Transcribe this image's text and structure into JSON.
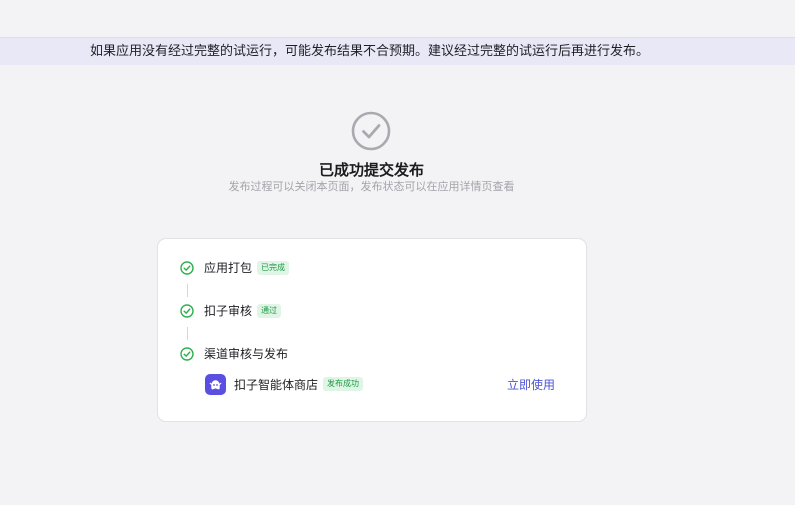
{
  "banner": {
    "text": "如果应用没有经过完整的试运行，可能发布结果不合预期。建议经过完整的试运行后再进行发布。"
  },
  "result": {
    "title": "已成功提交发布",
    "subtitle": "发布过程可以关闭本页面，发布状态可以在应用详情页查看"
  },
  "steps": [
    {
      "label": "应用打包",
      "tag": "已完成",
      "icon": "check-circle-icon"
    },
    {
      "label": "扣子审核",
      "tag": "通过",
      "icon": "check-circle-icon"
    },
    {
      "label": "渠道审核与发布",
      "icon": "check-circle-icon"
    }
  ],
  "channel": {
    "name": "扣子智能体商店",
    "status": "发布成功",
    "action": "立即使用",
    "logo_icon": "coze-store-icon"
  },
  "colors": {
    "success_green": "#2eb04f",
    "accent": "#4d54d6",
    "banner_bg": "#e8e8f7",
    "page_bg": "#f3f3f5"
  }
}
